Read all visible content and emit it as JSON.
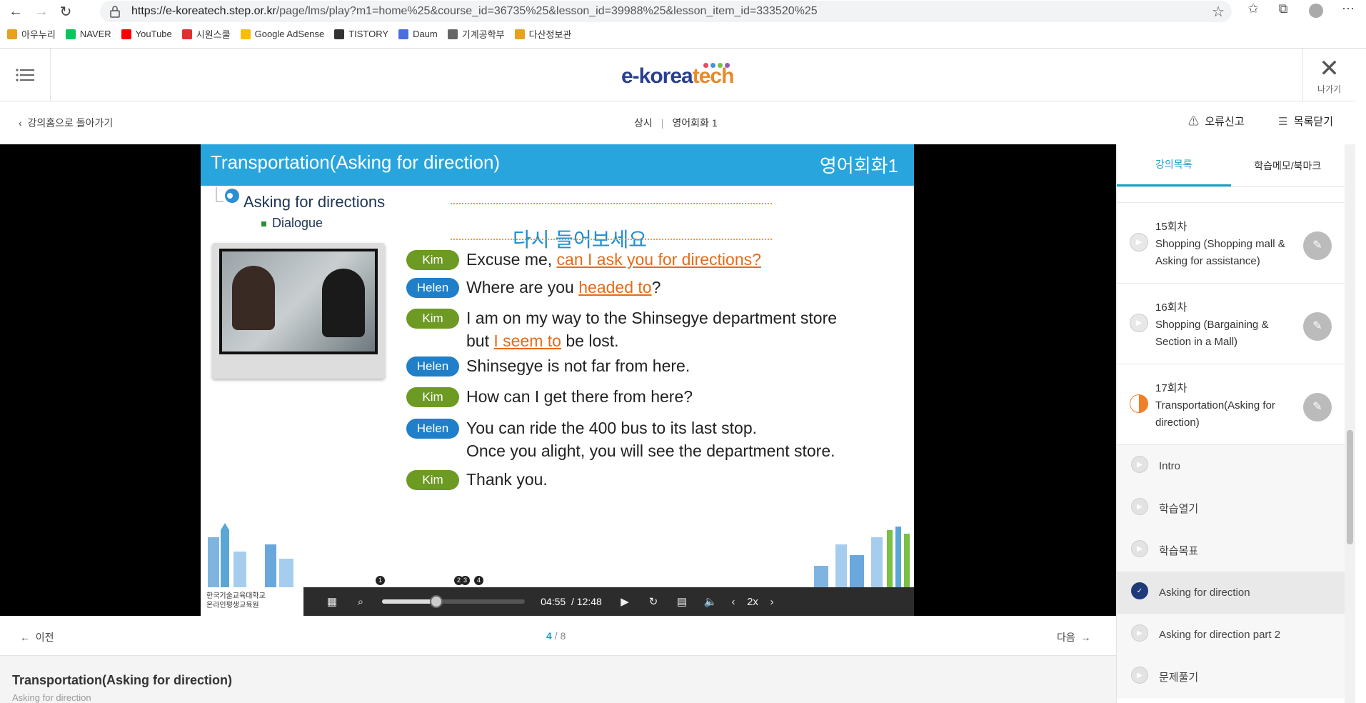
{
  "browser": {
    "url_host": "https://e-koreatech.step.or.kr",
    "url_path": "/page/lms/play?m1=home%25&course_id=36735%25&lesson_id=39988%25&lesson_item_id=333520%25",
    "bookmarks": [
      {
        "label": "아우누리",
        "icon": "bookmark-aunuri-icon",
        "color": "#e8a020"
      },
      {
        "label": "NAVER",
        "icon": "naver-icon",
        "color": "#03c75a"
      },
      {
        "label": "YouTube",
        "icon": "youtube-icon",
        "color": "#ff0000"
      },
      {
        "label": "시원스쿨",
        "icon": "siwon-icon",
        "color": "#e03030"
      },
      {
        "label": "Google AdSense",
        "icon": "adsense-icon",
        "color": "#fbbc04"
      },
      {
        "label": "TISTORY",
        "icon": "tistory-icon",
        "color": "#333333"
      },
      {
        "label": "Daum",
        "icon": "daum-icon",
        "color": "#4a6ee0"
      },
      {
        "label": "기계공학부",
        "icon": "page-icon",
        "color": "#666666"
      },
      {
        "label": "다산정보관",
        "icon": "bookmark-dasan-icon",
        "color": "#e8a020"
      }
    ]
  },
  "header": {
    "logo_main": "e-korea",
    "logo_accent": "tech",
    "exit_label": "나가기"
  },
  "subbar": {
    "back_label": "강의홈으로 돌아가기",
    "crumb_1": "상시",
    "crumb_2": "영어회화 1",
    "report_label": "오류신고",
    "close_list_label": "목록닫기"
  },
  "slide": {
    "title": "Transportation(Asking for direction)",
    "title_right": "영어회화1",
    "section": "Asking for directions",
    "section_sub": "Dialogue",
    "banner": "다시 들어보세요",
    "lines": [
      {
        "speaker": "Kim",
        "pre": "Excuse me, ",
        "hl": "can I ask you for directions?",
        "post": ""
      },
      {
        "speaker": "Helen",
        "pre": "Where are you ",
        "hl": "headed to",
        "post": "?"
      },
      {
        "speaker": "Kim",
        "pre": "I am on my way to the Shinsegye department store",
        "pre2": "but ",
        "hl": "I seem to",
        "post": " be lost."
      },
      {
        "speaker": "Helen",
        "pre": "Shinsegye is not far from here.",
        "hl": "",
        "post": ""
      },
      {
        "speaker": "Kim",
        "pre": "How can I get there from here?",
        "hl": "",
        "post": ""
      },
      {
        "speaker": "Helen",
        "pre": "You can ride the 400 bus to its last stop.",
        "pre2": "Once you alight, you will see the department store.",
        "hl": "",
        "post": ""
      },
      {
        "speaker": "Kim",
        "pre": "Thank you.",
        "hl": "",
        "post": ""
      }
    ],
    "footer_logo_line1": "한국기술교육대학교",
    "footer_logo_line2": "온라인평생교육원",
    "markers": [
      "1",
      "2",
      "3",
      "4"
    ]
  },
  "player": {
    "current_time": "04:55",
    "total_time": "/ 12:48",
    "speed": "2x",
    "progress": 0.38
  },
  "sidebar": {
    "tab_1": "강의목록",
    "tab_2": "학습메모/북마크",
    "lessons": [
      {
        "num": "15회차",
        "title": "Shopping (Shopping mall & Asking for assistance)"
      },
      {
        "num": "16회차",
        "title": "Shopping (Bargaining & Section in a Mall)"
      },
      {
        "num": "17회차",
        "title": "Transportation(Asking for direction)"
      }
    ],
    "items": [
      {
        "label": "Intro",
        "state": "unplayed"
      },
      {
        "label": "학습열기",
        "state": "unplayed"
      },
      {
        "label": "학습목표",
        "state": "unplayed"
      },
      {
        "label": "Asking for direction",
        "state": "current"
      },
      {
        "label": "Asking for direction part 2",
        "state": "unplayed"
      },
      {
        "label": "문제풀기",
        "state": "unplayed"
      }
    ]
  },
  "pager": {
    "prev_label": "이전",
    "next_label": "다음",
    "current": "4",
    "total": " / 8"
  },
  "bottom": {
    "title": "Transportation(Asking for direction)",
    "subtitle": "Asking for direction"
  }
}
